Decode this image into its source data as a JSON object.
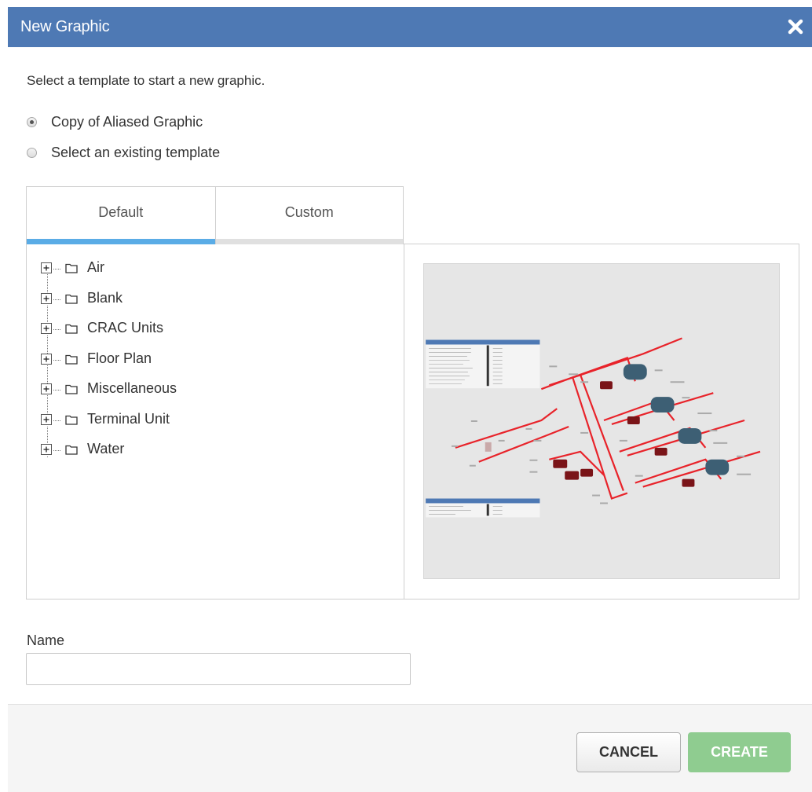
{
  "dialog": {
    "title": "New Graphic",
    "close_icon": "close-x-icon",
    "header_color": "#4e79b4"
  },
  "instructions": "Select a template to start a new graphic.",
  "options": [
    {
      "label": "Copy of Aliased Graphic",
      "checked": true
    },
    {
      "label": "Select an existing template",
      "checked": false
    }
  ],
  "tabs": [
    {
      "label": "Default",
      "active": true
    },
    {
      "label": "Custom",
      "active": false
    }
  ],
  "tree": {
    "items": [
      {
        "label": "Air"
      },
      {
        "label": "Blank"
      },
      {
        "label": "CRAC Units"
      },
      {
        "label": "Floor Plan"
      },
      {
        "label": "Miscellaneous"
      },
      {
        "label": "Terminal Unit"
      },
      {
        "label": "Water"
      }
    ],
    "expand_icon": "plus-box-icon",
    "folder_icon": "folder-icon"
  },
  "preview": {
    "accent_color": "#e8232a",
    "header_color": "#4e79b4"
  },
  "name_field": {
    "label": "Name",
    "value": "",
    "placeholder": ""
  },
  "buttons": {
    "cancel": "CANCEL",
    "create": "CREATE",
    "create_color": "#8fcc90"
  }
}
